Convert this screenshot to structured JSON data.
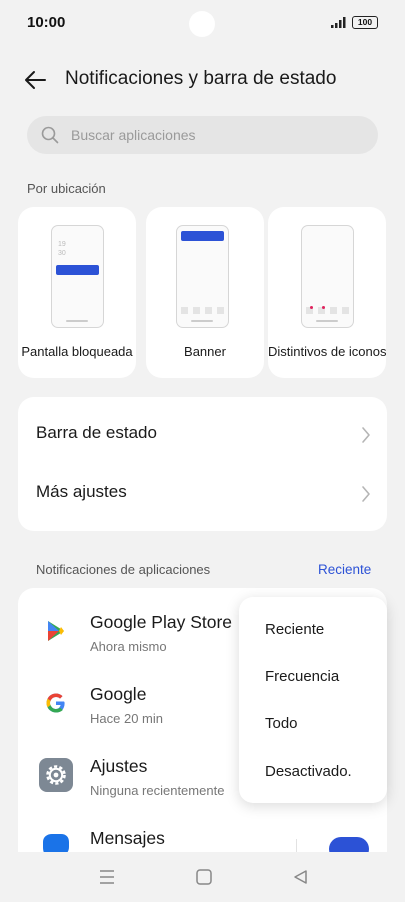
{
  "status_bar": {
    "time": "10:00",
    "battery": "100",
    "icons": [
      "signal-icon",
      "battery-icon"
    ]
  },
  "header": {
    "title": "Notificaciones y barra de estado",
    "back_icon": "back-arrow-icon"
  },
  "search": {
    "placeholder": "Buscar aplicaciones",
    "value": ""
  },
  "location": {
    "label": "Por ubicación",
    "cards": [
      {
        "label": "Pantalla bloqueada",
        "preview_text": "19\n30"
      },
      {
        "label": "Banner"
      },
      {
        "label": "Distintivos de iconos"
      }
    ]
  },
  "settings": {
    "items": [
      {
        "label": "Barra de estado"
      },
      {
        "label": "Más ajustes"
      }
    ]
  },
  "app_notifications": {
    "label": "Notificaciones de aplicaciones",
    "sort_label": "Reciente",
    "apps": [
      {
        "name": "Google Play Store",
        "subtitle": "Ahora mismo",
        "icon": "google-play-icon"
      },
      {
        "name": "Google",
        "subtitle": "Hace 20 min",
        "icon": "google-icon"
      },
      {
        "name": "Ajustes",
        "subtitle": "Ninguna recientemente",
        "icon": "settings-gear-icon"
      },
      {
        "name": "Mensajes",
        "subtitle": "",
        "icon": "messages-icon",
        "toggle_on": true
      }
    ]
  },
  "sort_menu": {
    "options": [
      "Reciente",
      "Frecuencia",
      "Todo",
      "Desactivado."
    ]
  },
  "nav": {
    "icons": [
      "menu-icon",
      "home-icon",
      "back-icon"
    ]
  },
  "colors": {
    "accent": "#2c52d6",
    "background": "#f2f2f2",
    "card": "#ffffff"
  }
}
